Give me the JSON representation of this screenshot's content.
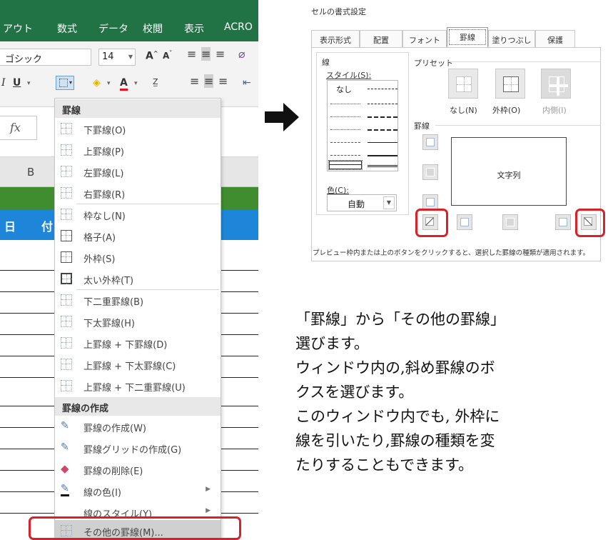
{
  "excel": {
    "ribbon_tabs": [
      "アウト",
      "数式",
      "データ",
      "校閲",
      "表示",
      "ACRO"
    ],
    "font_name": "ゴシック",
    "font_size": "14",
    "row2_glyphs": [
      "I",
      "U",
      "A"
    ],
    "fx_label": "fx",
    "column_letter": "B",
    "header_text": [
      "日",
      "付"
    ],
    "menu": {
      "section1_title": "罫線",
      "section1_items": [
        "下罫線(O)",
        "上罫線(P)",
        "左罫線(L)",
        "右罫線(R)",
        "枠なし(N)",
        "格子(A)",
        "外枠(S)",
        "太い外枠(T)",
        "下二重罫線(B)",
        "下太罫線(H)",
        "上罫線 + 下罫線(D)",
        "上罫線 + 下太罫線(C)",
        "上罫線 + 下二重罫線(U)"
      ],
      "section2_title": "罫線の作成",
      "section2_items": [
        "罫線の作成(W)",
        "罫線グリッドの作成(G)",
        "罫線の削除(E)",
        "線の色(I)",
        "線のスタイル(Y)",
        "その他の罫線(M)..."
      ]
    }
  },
  "dialog": {
    "title": "セルの書式設定",
    "tabs": [
      "表示形式",
      "配置",
      "フォント",
      "罫線",
      "塗りつぶし",
      "保護"
    ],
    "active_tab": "罫線",
    "line_group": "線",
    "style_label": "スタイル(S):",
    "style_none": "なし",
    "color_label": "色(C):",
    "color_value": "自動",
    "preset_group": "プリセット",
    "preset_labels": [
      "なし(N)",
      "外枠(O)",
      "内側(I)"
    ],
    "border_group": "罫線",
    "preview_text": "文字列",
    "note": "プレビュー枠内または上のボタンをクリックすると、選択した罫線の種類が適用されます。"
  },
  "explanation": [
    "「罫線」から「その他の罫線」",
    "選びます。",
    "ウィンドウ内の,斜め罫線のボ",
    "クスを選びます。",
    "このウィンドウ内でも, 外枠に",
    "線を引いたり,罫線の種類を変",
    "たりすることもできます。"
  ],
  "colors": {
    "excel_green": "#217346",
    "header_blue": "#1e86d8",
    "highlight_red": "#d92128"
  }
}
